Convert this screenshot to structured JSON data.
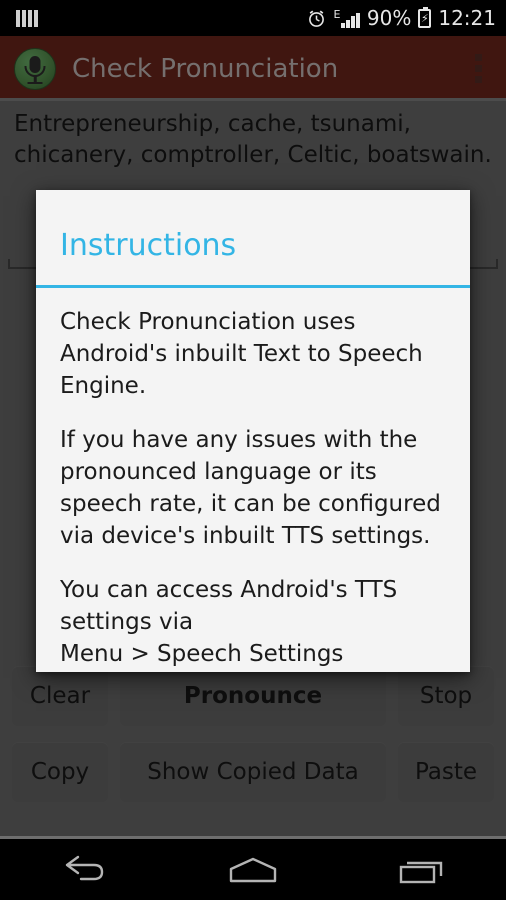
{
  "statusbar": {
    "notification_icon": "equalizer-icon",
    "alarm_icon": "alarm-clock-icon",
    "network_type": "E",
    "signal_icon": "signal-bars-icon",
    "battery_percent": "90%",
    "battery_icon": "battery-charging-icon",
    "clock": "12:21"
  },
  "actionbar": {
    "app_icon": "microphone-icon",
    "title": "Check Pronunciation",
    "overflow_icon": "more-vertical-icon"
  },
  "editor": {
    "text": "Entrepreneurship, cache, tsunami, chicanery, comptroller, Celtic, boatswain."
  },
  "buttons": {
    "row1": [
      {
        "label": "Clear",
        "name": "clear-button",
        "bold": false
      },
      {
        "label": "Pronounce",
        "name": "pronounce-button",
        "bold": true
      },
      {
        "label": "Stop",
        "name": "stop-button",
        "bold": false
      }
    ],
    "row2": [
      {
        "label": "Copy",
        "name": "copy-button",
        "bold": false
      },
      {
        "label": "Show Copied Data",
        "name": "show-copied-data-button",
        "bold": false
      },
      {
        "label": "Paste",
        "name": "paste-button",
        "bold": false
      }
    ]
  },
  "dialog": {
    "title": "Instructions",
    "paragraph1": "Check Pronunciation uses Android's inbuilt Text to Speech Engine.",
    "paragraph2": "If you have any issues with the pronounced language or its speech rate, it can be configured via device's inbuilt TTS settings.",
    "paragraph3_line1": "You can access Android's TTS settings via",
    "paragraph3_line2": "Menu > Speech Settings"
  },
  "navbar": {
    "back": "back-icon",
    "home": "home-icon",
    "recents": "recents-icon"
  },
  "colors": {
    "actionbar": "#5c2018",
    "body": "#5a5a5a",
    "accent": "#33b5e5",
    "dialog_bg": "#f4f4f4",
    "button": "#565656"
  }
}
